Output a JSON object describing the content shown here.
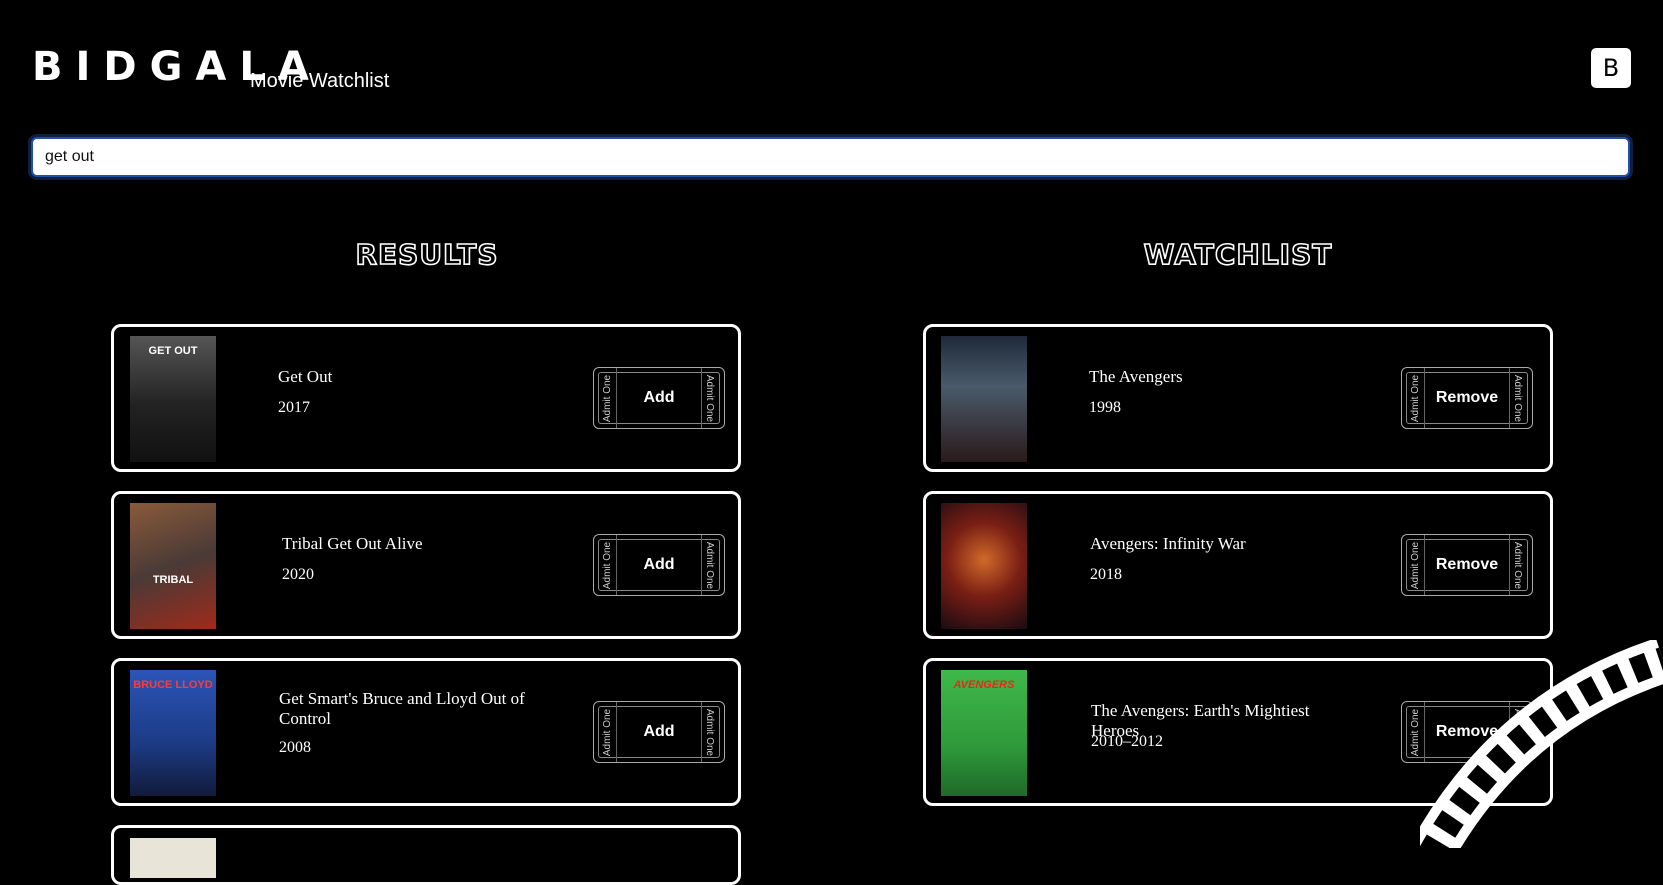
{
  "header": {
    "brand": "BIDGALA",
    "subtitle": "Movie Watchlist",
    "avatar_letter": "B"
  },
  "search": {
    "value": "get out",
    "placeholder": ""
  },
  "results": {
    "title": "RESULTS",
    "button_label": "Add",
    "ticket_text": "Admit One",
    "items": [
      {
        "title": "Get Out",
        "year": "2017",
        "poster_text": "GET OUT",
        "poster_color": "#3a3a3a"
      },
      {
        "title": "Tribal Get Out Alive",
        "year": "2020",
        "poster_text": "TRIBAL",
        "poster_color": "#6b3a2a"
      },
      {
        "title": "Get Smart's Bruce and Lloyd Out of Control",
        "year": "2008",
        "poster_text": "BRUCE LLOYD",
        "poster_color": "#1f3f8a"
      }
    ]
  },
  "watchlist": {
    "title": "WATCHLIST",
    "button_label": "Remove",
    "ticket_text": "Admit One",
    "items": [
      {
        "title": "The Avengers",
        "year": "1998",
        "poster_text": "",
        "poster_color": "#3b4656"
      },
      {
        "title": "Avengers: Infinity War",
        "year": "2018",
        "poster_text": "",
        "poster_color": "#7a1f14"
      },
      {
        "title": "The Avengers: Earth's Mightiest Heroes",
        "year": "2010–2012",
        "poster_text": "AVENGERS",
        "poster_color": "#2f9a3a"
      }
    ]
  }
}
